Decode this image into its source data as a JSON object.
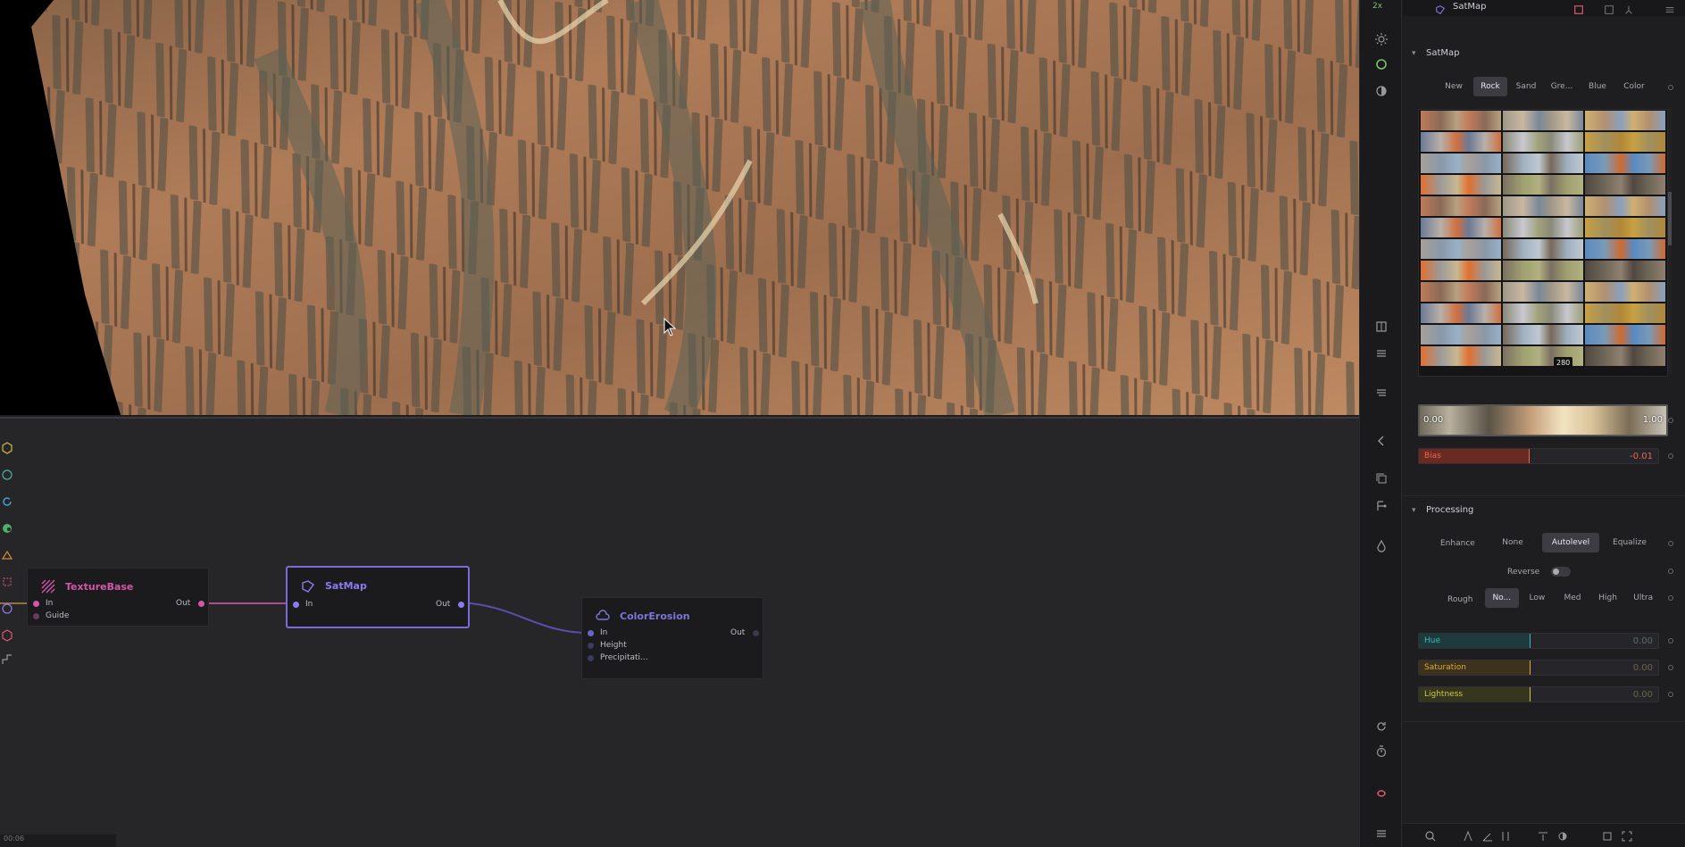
{
  "toolbar": {
    "top_label": "2x"
  },
  "graph": {
    "nodes": {
      "texturebase": {
        "title": "TextureBase",
        "in": "In",
        "guide": "Guide",
        "out": "Out",
        "color": "#d456a8"
      },
      "satmap": {
        "title": "SatMap",
        "in": "In",
        "out": "Out",
        "color": "#8a7cf0"
      },
      "colorerosion": {
        "title": "ColorErosion",
        "in": "In",
        "height": "Height",
        "precip": "Precipitati...",
        "out": "Out",
        "color": "#7a76d8"
      }
    },
    "status": "00:06"
  },
  "panel": {
    "header_title": "SatMap",
    "satmap_section": {
      "title": "SatMap",
      "tabs": [
        {
          "label": "New",
          "active": false
        },
        {
          "label": "Rock",
          "active": true
        },
        {
          "label": "Sand",
          "active": false
        },
        {
          "label": "Gre...",
          "active": false
        },
        {
          "label": "Blue",
          "active": false
        },
        {
          "label": "Color",
          "active": false
        }
      ],
      "gallery_badge": "280",
      "range_min": "0.00",
      "range_max": "1.00",
      "bias": {
        "label": "Bias",
        "value": "-0.01",
        "color": "#e46a4e"
      }
    },
    "processing_section": {
      "title": "Processing",
      "enhance_label": "Enhance",
      "enhance_options": [
        {
          "label": "None",
          "active": false
        },
        {
          "label": "Autolevel",
          "active": true
        },
        {
          "label": "Equalize",
          "active": false
        }
      ],
      "reverse_label": "Reverse",
      "rough_label": "Rough",
      "rough_options": [
        {
          "label": "No...",
          "active": true
        },
        {
          "label": "Low",
          "active": false
        },
        {
          "label": "Med",
          "active": false
        },
        {
          "label": "High",
          "active": false
        },
        {
          "label": "Ultra",
          "active": false
        }
      ],
      "hue": {
        "label": "Hue",
        "value": "0.00",
        "color": "#3fb6b6"
      },
      "saturation": {
        "label": "Saturation",
        "value": "0.00",
        "color": "#e0a83a"
      },
      "lightness": {
        "label": "Lightness",
        "value": "0.00",
        "color": "#c8c84e"
      }
    }
  }
}
